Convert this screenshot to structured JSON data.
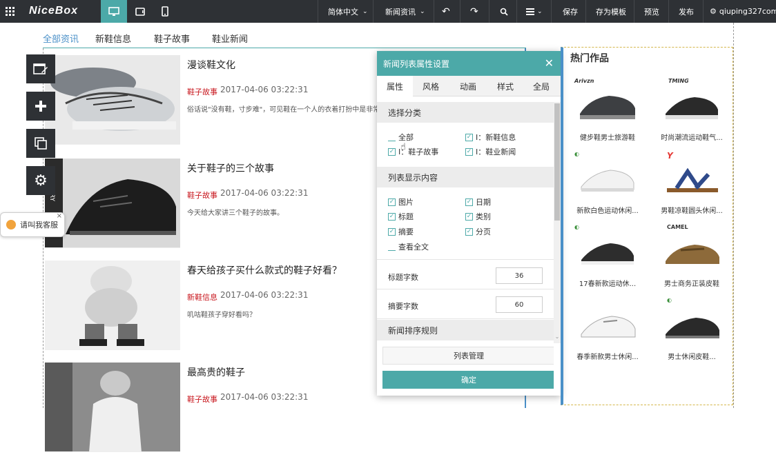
{
  "toolbar": {
    "logo": "NiceBox",
    "language": "简体中文",
    "news_list": "新闻资讯",
    "save": "保存",
    "save_as_template": "存为模板",
    "preview": "预览",
    "publish": "发布",
    "user": "qiuping327com473"
  },
  "nav": {
    "tabs": [
      "全部资讯",
      "新鞋信息",
      "鞋子故事",
      "鞋业新闻"
    ]
  },
  "articles": [
    {
      "title": "漫谈鞋文化",
      "category": "鞋子故事",
      "date": "2017-04-06 03:22:31",
      "summary": "俗话说\"没有鞋，寸步难\"，可见鞋在一个人的衣着打扮中是非常重要"
    },
    {
      "title": "关于鞋子的三个故事",
      "category": "鞋子故事",
      "date": "2017-04-06 03:22:31",
      "summary": "今天给大家讲三个鞋子的故事。"
    },
    {
      "title": "春天给孩子买什么款式的鞋子好看？",
      "category": "新鞋信息",
      "date": "2017-04-06 03:22:31",
      "summary": "叽咕鞋孩子穿好看吗？"
    },
    {
      "title": "最高贵的鞋子",
      "category": "鞋子故事",
      "date": "2017-04-06 03:22:31",
      "summary": ""
    }
  ],
  "chat": {
    "label": "请叫我客服"
  },
  "panel": {
    "title": "新闻列表属性设置",
    "tabs": [
      "属性",
      "风格",
      "动画",
      "样式",
      "全局"
    ],
    "category_section": "选择分类",
    "categories": [
      {
        "label": "全部",
        "checked": false
      },
      {
        "label": "I：新鞋信息",
        "checked": true
      },
      {
        "label": "I：鞋子故事",
        "checked": true
      },
      {
        "label": "I：鞋业新闻",
        "checked": true
      }
    ],
    "display_section": "列表显示内容",
    "display_options": [
      {
        "label": "图片",
        "checked": true
      },
      {
        "label": "日期",
        "checked": true
      },
      {
        "label": "标题",
        "checked": true
      },
      {
        "label": "类别",
        "checked": true
      },
      {
        "label": "摘要",
        "checked": true
      },
      {
        "label": "分页",
        "checked": true
      },
      {
        "label": "查看全文",
        "checked": false
      }
    ],
    "title_chars_label": "标题字数",
    "title_chars_value": "36",
    "summary_chars_label": "摘要字数",
    "summary_chars_value": "60",
    "sort_section": "新闻排序规则",
    "list_manage": "列表管理",
    "confirm": "确定"
  },
  "hot": {
    "title": "热门作品",
    "products": [
      {
        "brand": "Arivzn",
        "name": "健步鞋男士旅游鞋"
      },
      {
        "brand": "TMING",
        "name": "时尚潮流运动鞋气..."
      },
      {
        "brand": "",
        "name": "新款白色运动休闲..."
      },
      {
        "brand": "Y",
        "name": "男鞋凉鞋圆头休闲..."
      },
      {
        "brand": "",
        "name": "17春新款运动休..."
      },
      {
        "brand": "CAMEL",
        "name": "男士商务正装皮鞋"
      },
      {
        "brand": "",
        "name": "春季新款男士休闲..."
      },
      {
        "brand": "",
        "name": "男士休闲皮鞋..."
      }
    ]
  },
  "colors": {
    "accent": "#4ca9a8",
    "topbar": "#2e3135",
    "category_red": "#c8161d",
    "link_blue": "#4a90c8"
  }
}
